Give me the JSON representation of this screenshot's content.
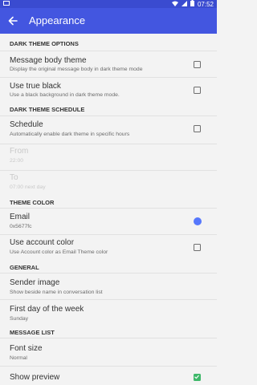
{
  "status_bar": {
    "time": "07:52"
  },
  "toolbar": {
    "title": "Appearance",
    "back_icon": "arrow-left-icon"
  },
  "sections": {
    "dark_theme_options": "DARK THEME OPTIONS",
    "dark_theme_schedule": "DARK THEME SCHEDULE",
    "theme_color": "THEME COLOR",
    "general": "GENERAL",
    "message_list": "MESSAGE LIST"
  },
  "items": {
    "message_body_theme": {
      "title": "Message body theme",
      "summary": "Display the original message body in dark theme mode",
      "checked": false
    },
    "use_true_black": {
      "title": "Use true black",
      "summary": "Use a black background in dark theme mode.",
      "checked": false
    },
    "schedule": {
      "title": "Schedule",
      "summary": "Automatically enable dark theme in specific hours",
      "checked": false
    },
    "from": {
      "title": "From",
      "summary": "22:00"
    },
    "to": {
      "title": "To",
      "summary": "07:00 next day"
    },
    "email": {
      "title": "Email",
      "summary": "0x5677fc",
      "color": "#5677fc"
    },
    "use_account_color": {
      "title": "Use account color",
      "summary": "Use Account color as Email Theme color",
      "checked": false
    },
    "sender_image": {
      "title": "Sender image",
      "summary": "Show beside name in conversation list"
    },
    "first_day_of_week": {
      "title": "First day of the week",
      "summary": "Sunday"
    },
    "font_size": {
      "title": "Font size",
      "summary": "Normal"
    },
    "show_preview": {
      "title": "Show preview",
      "checked": true
    }
  },
  "colors": {
    "status_bar": "#3a4bd0",
    "toolbar": "#4356e0",
    "check_on": "#3fb86a"
  }
}
